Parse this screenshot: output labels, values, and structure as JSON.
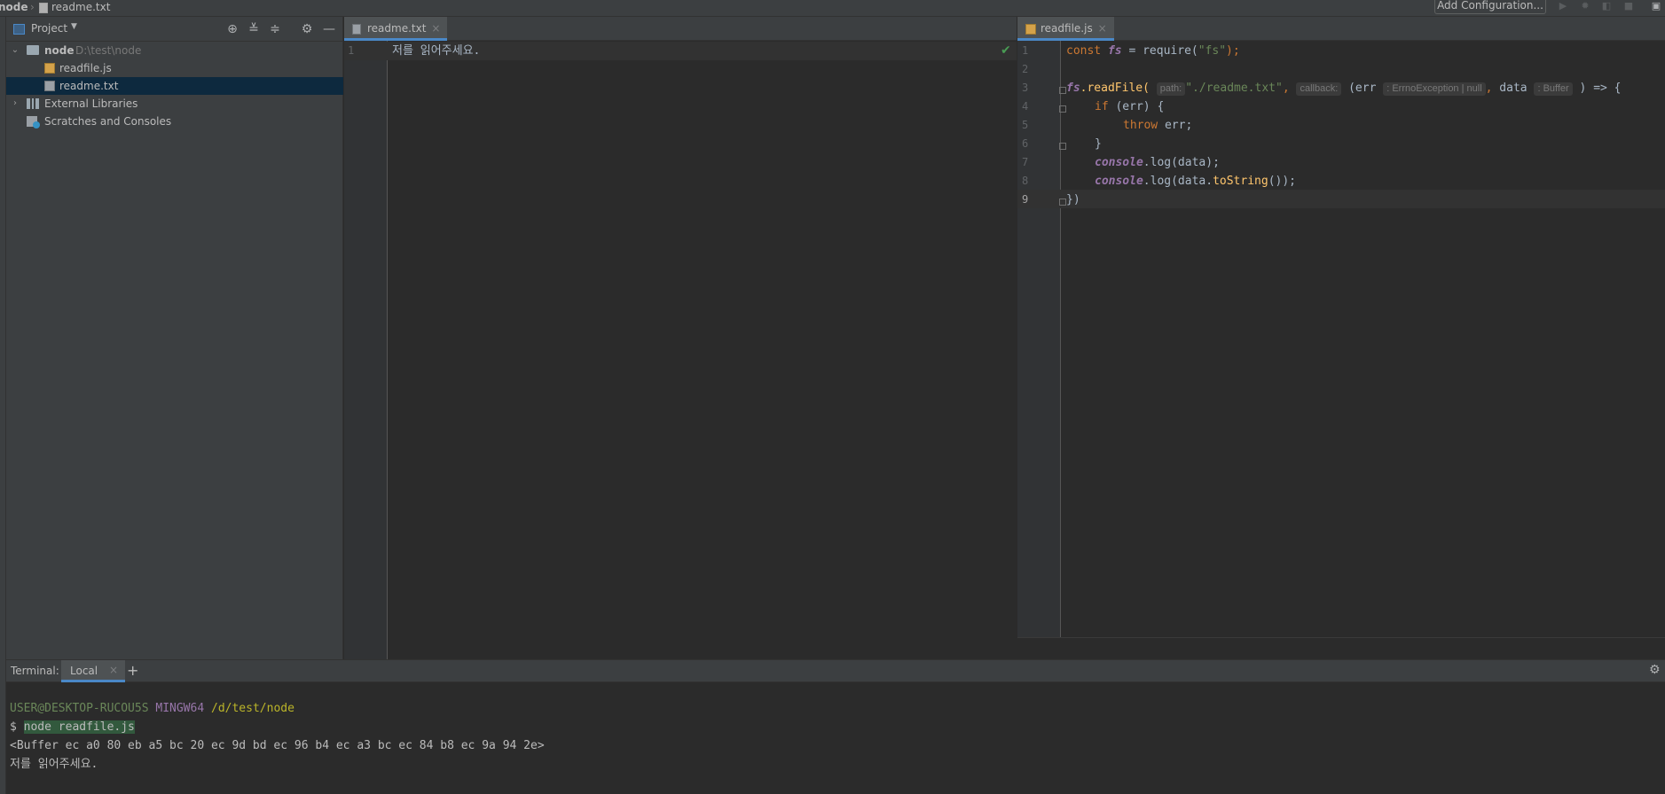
{
  "breadcrumb": {
    "project": "node",
    "file": "readme.txt"
  },
  "toolbar": {
    "add_configuration": "Add Configuration..."
  },
  "project_panel": {
    "title": "Project",
    "root": {
      "name": "node",
      "path": "D:\\test\\node"
    },
    "files": [
      "readfile.js",
      "readme.txt"
    ],
    "external_libraries": "External Libraries",
    "scratches": "Scratches and Consoles"
  },
  "editor_left": {
    "tab": "readme.txt",
    "line_numbers": [
      "1"
    ],
    "content": "저를 읽어주세요."
  },
  "editor_right": {
    "tab": "readfile.js",
    "line_numbers": [
      "1",
      "2",
      "3",
      "4",
      "5",
      "6",
      "7",
      "8",
      "9"
    ],
    "code": {
      "l1_const": "const ",
      "l1_fs": "fs",
      "l1_rest": " = require(",
      "l1_str": "\"fs\"",
      "l1_end": ");",
      "l3_fs": "fs",
      "l3_method": ".readFile(",
      "l3_hint_path": "path:",
      "l3_str": "\"./readme.txt\"",
      "l3_comma": ",",
      "l3_hint_callback": "callback:",
      "l3_err": " (err",
      "l3_hint_err_type": ": ErrnoException | null",
      "l3_comma2": ",",
      "l3_data": " data",
      "l3_hint_data_type": ": Buffer",
      "l3_arrow": ") => {",
      "l4_if": "if",
      "l4_rest": " (err) {",
      "l5_throw": "throw",
      "l5_rest": " err;",
      "l6": "}",
      "l7_console": "console",
      "l7_rest": ".log(data);",
      "l8_console": "console",
      "l8_dotlog": ".log(data.",
      "l8_tostring": "toString",
      "l8_end": "());",
      "l9": "})"
    }
  },
  "terminal": {
    "label": "Terminal:",
    "tab": "Local",
    "prompt_user": "USER@DESKTOP-RUCOU5S",
    "prompt_env": "MINGW64",
    "prompt_path": "/d/test/node",
    "command_symbol": "$",
    "command": "node readfile.js",
    "output_buffer": "<Buffer ec a0 80 eb a5 bc 20 ec 9d bd ec 96 b4 ec a3 bc ec 84 b8 ec 9a 94 2e>",
    "output_text": "저를 읽어주세요."
  },
  "icons": {
    "project": "project-view-icon",
    "locate": "locate-icon",
    "expand_all": "expand-all-icon",
    "collapse_all": "collapse-all-icon",
    "settings": "gear-icon",
    "hide": "hide-icon"
  },
  "colors": {
    "selection": "#0d293e",
    "keyword": "#cc7832",
    "string": "#6a8759",
    "tab_underline": "#4a88c7",
    "check": "#499c54"
  }
}
